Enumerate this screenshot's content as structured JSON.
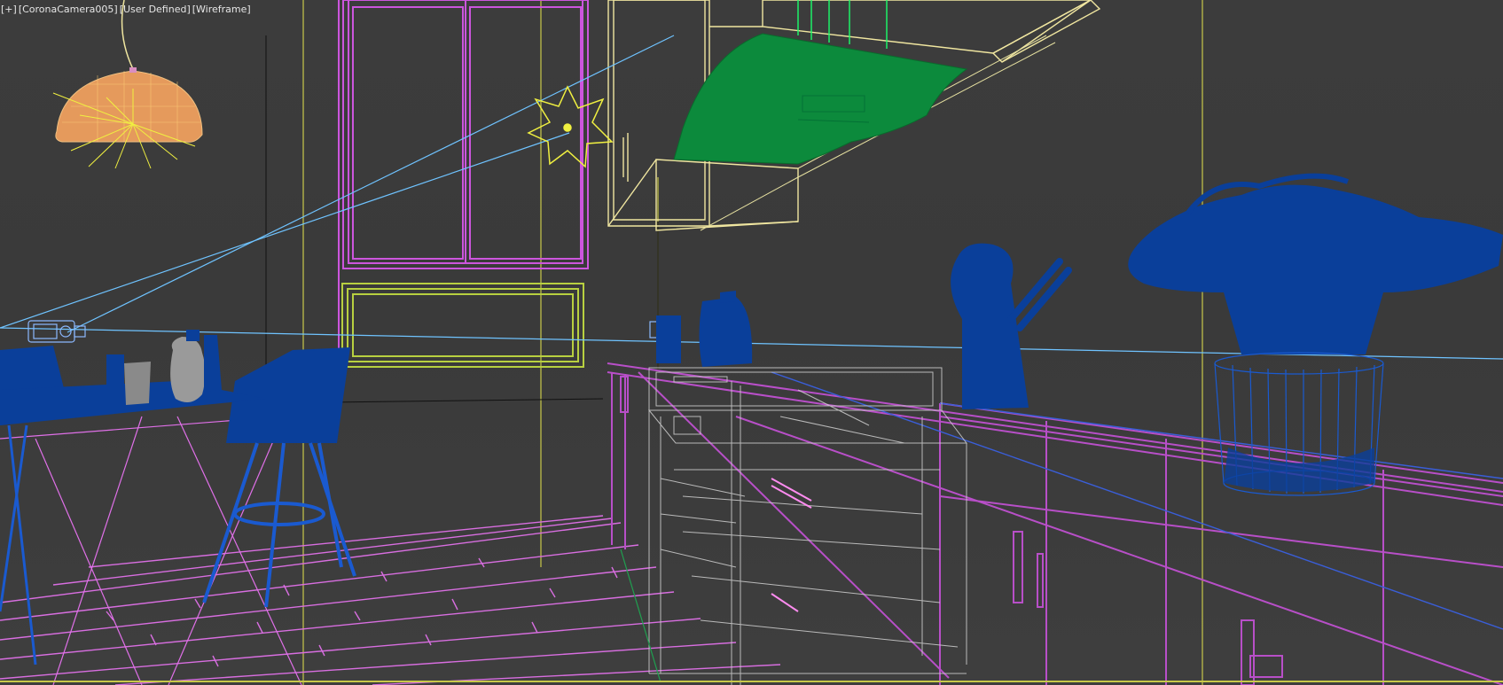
{
  "viewport": {
    "label": {
      "plus": "[+]",
      "camera": "[CoronaCamera005]",
      "view_type": "[User Defined]",
      "shading": "[Wireframe]"
    },
    "colors": {
      "background": "#3a3a3a",
      "window_frame": "#cc55dd",
      "floor_boards": "#d86ee0",
      "cabinets_upper": "#f0e6a0",
      "range_hood": "#0c8a3c",
      "lamp": "#e59a5c",
      "light_source": "#f0f040",
      "camera_target_line": "#6fc3ff",
      "appliances": "#d0d0d0",
      "props_blue": "#0a3f9a",
      "props_grey": "#8a8a8a",
      "radiator": "#b8d040",
      "cabinet_base": "#b84fc8"
    },
    "icons": [
      "camera-icon",
      "light-star-icon",
      "pendant-lamp-icon",
      "plant-icon"
    ]
  }
}
